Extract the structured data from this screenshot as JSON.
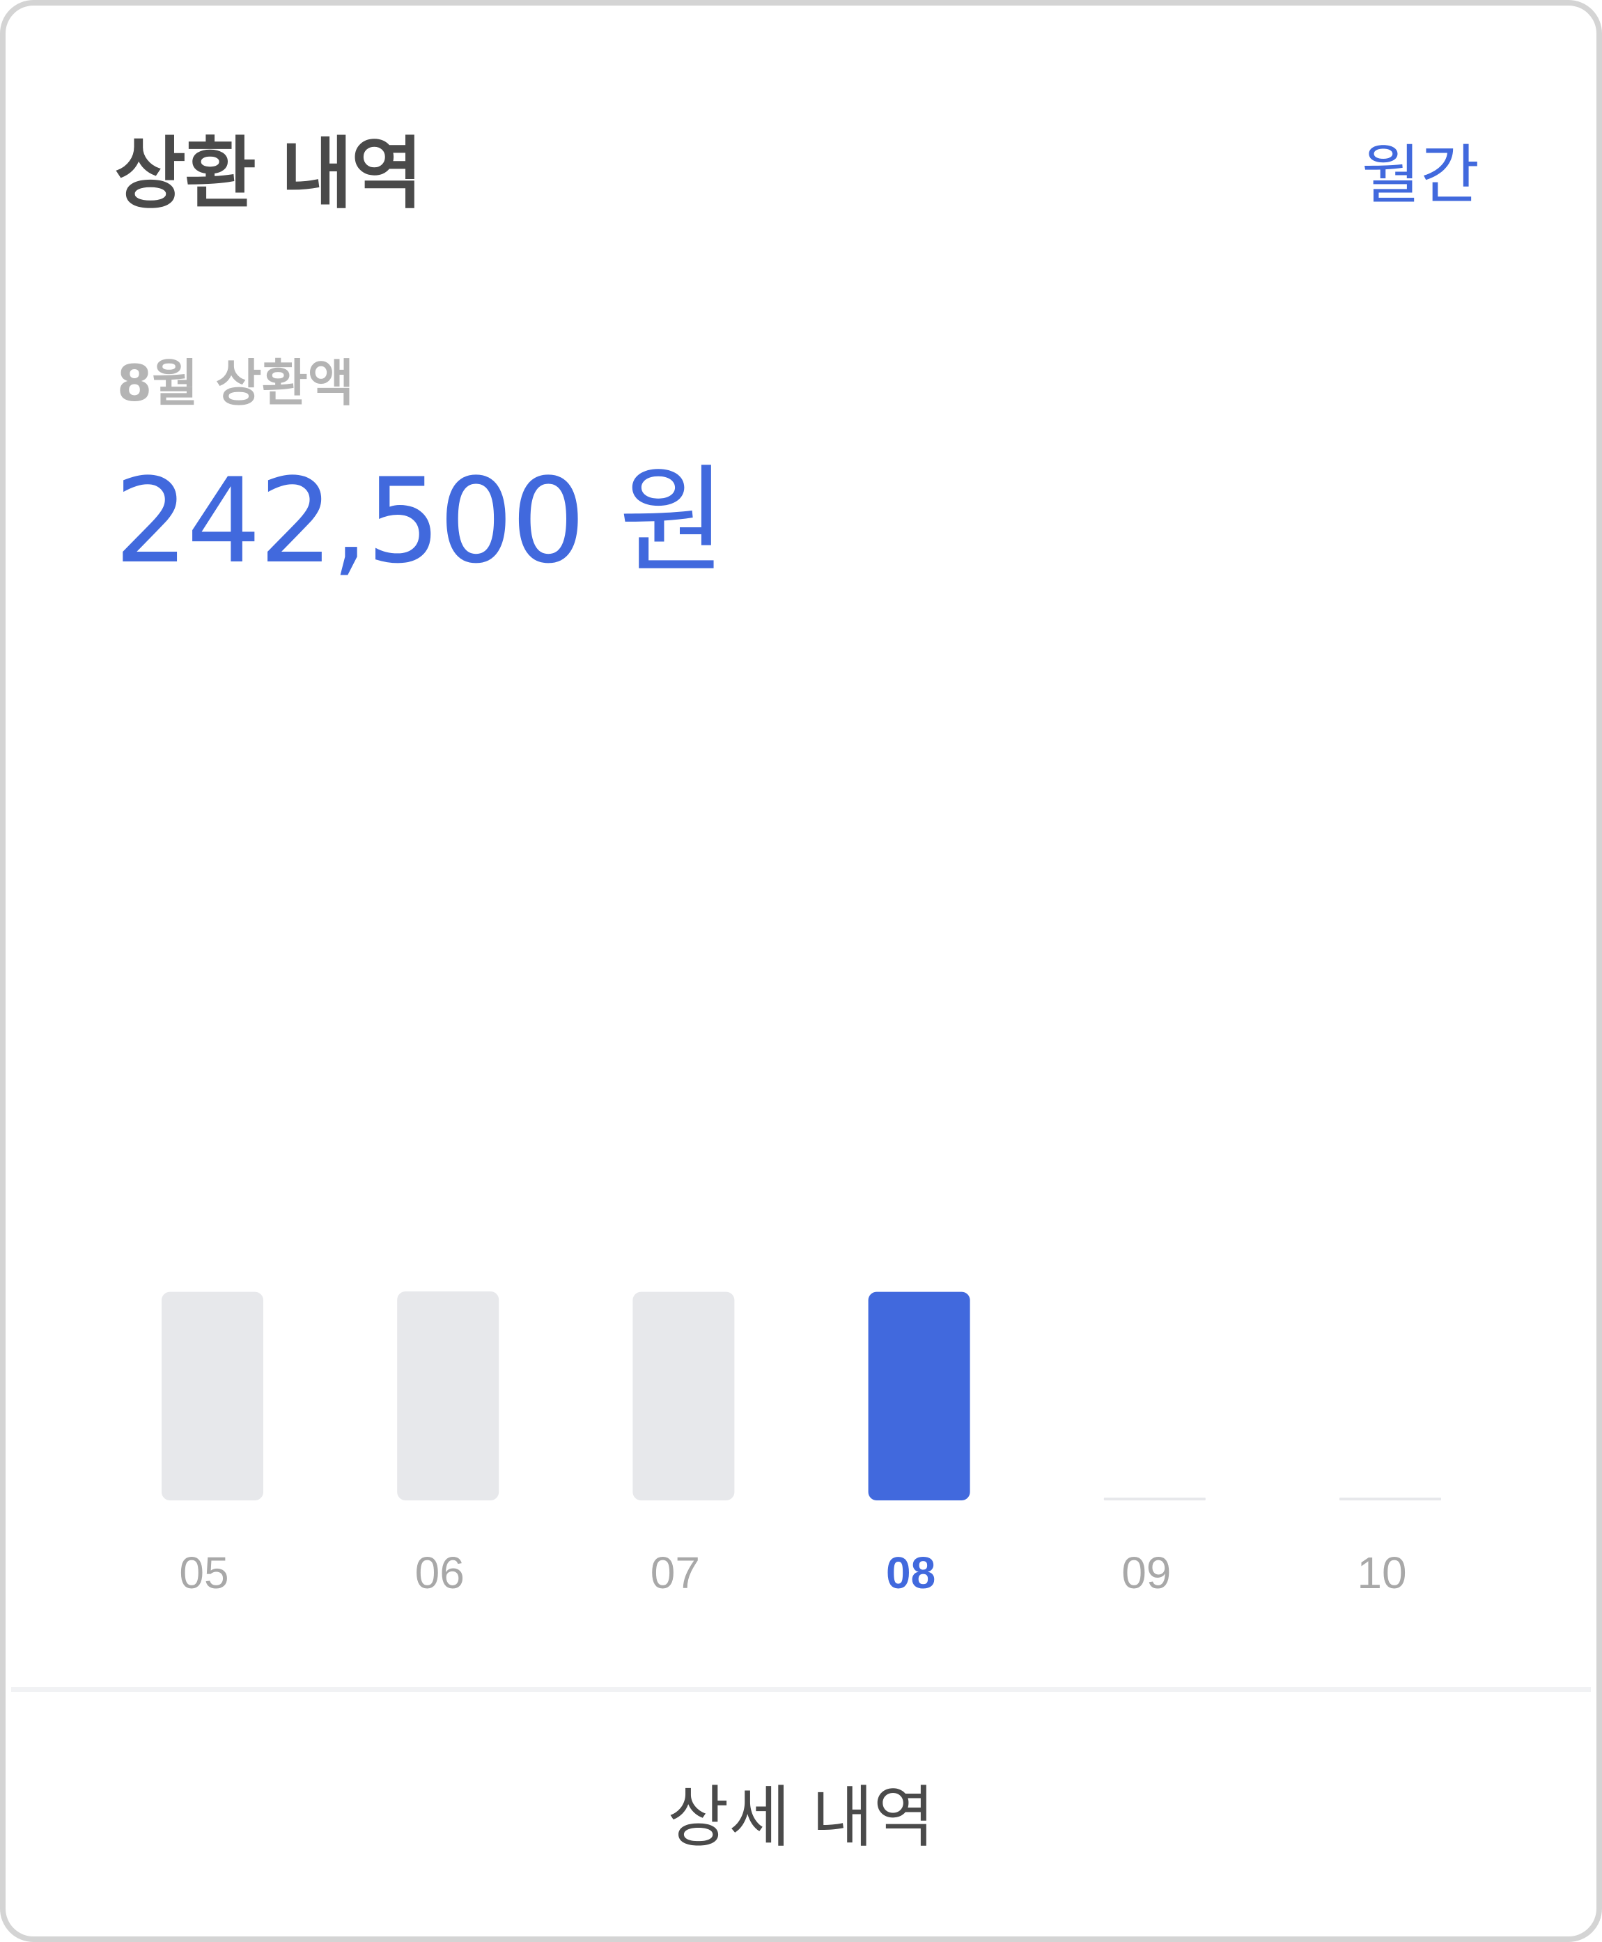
{
  "header": {
    "title": "상환 내역",
    "period_toggle": "월간"
  },
  "summary": {
    "label": "8월 상환액",
    "amount": "242,500 원"
  },
  "chart_data": {
    "type": "bar",
    "categories": [
      "05",
      "06",
      "07",
      "08",
      "09",
      "10"
    ],
    "values": [
      242500,
      243000,
      242500,
      242500,
      0,
      0
    ],
    "selected_index": 3,
    "ylim": [
      0,
      243000
    ],
    "grid": false,
    "colors": {
      "selected": "#4169dd",
      "default": "#e7e8eb",
      "empty": "#e7e8eb",
      "tick_default": "#a8a8a8",
      "tick_selected": "#4169dd"
    }
  },
  "footer": {
    "detail_button": "상세 내역"
  }
}
